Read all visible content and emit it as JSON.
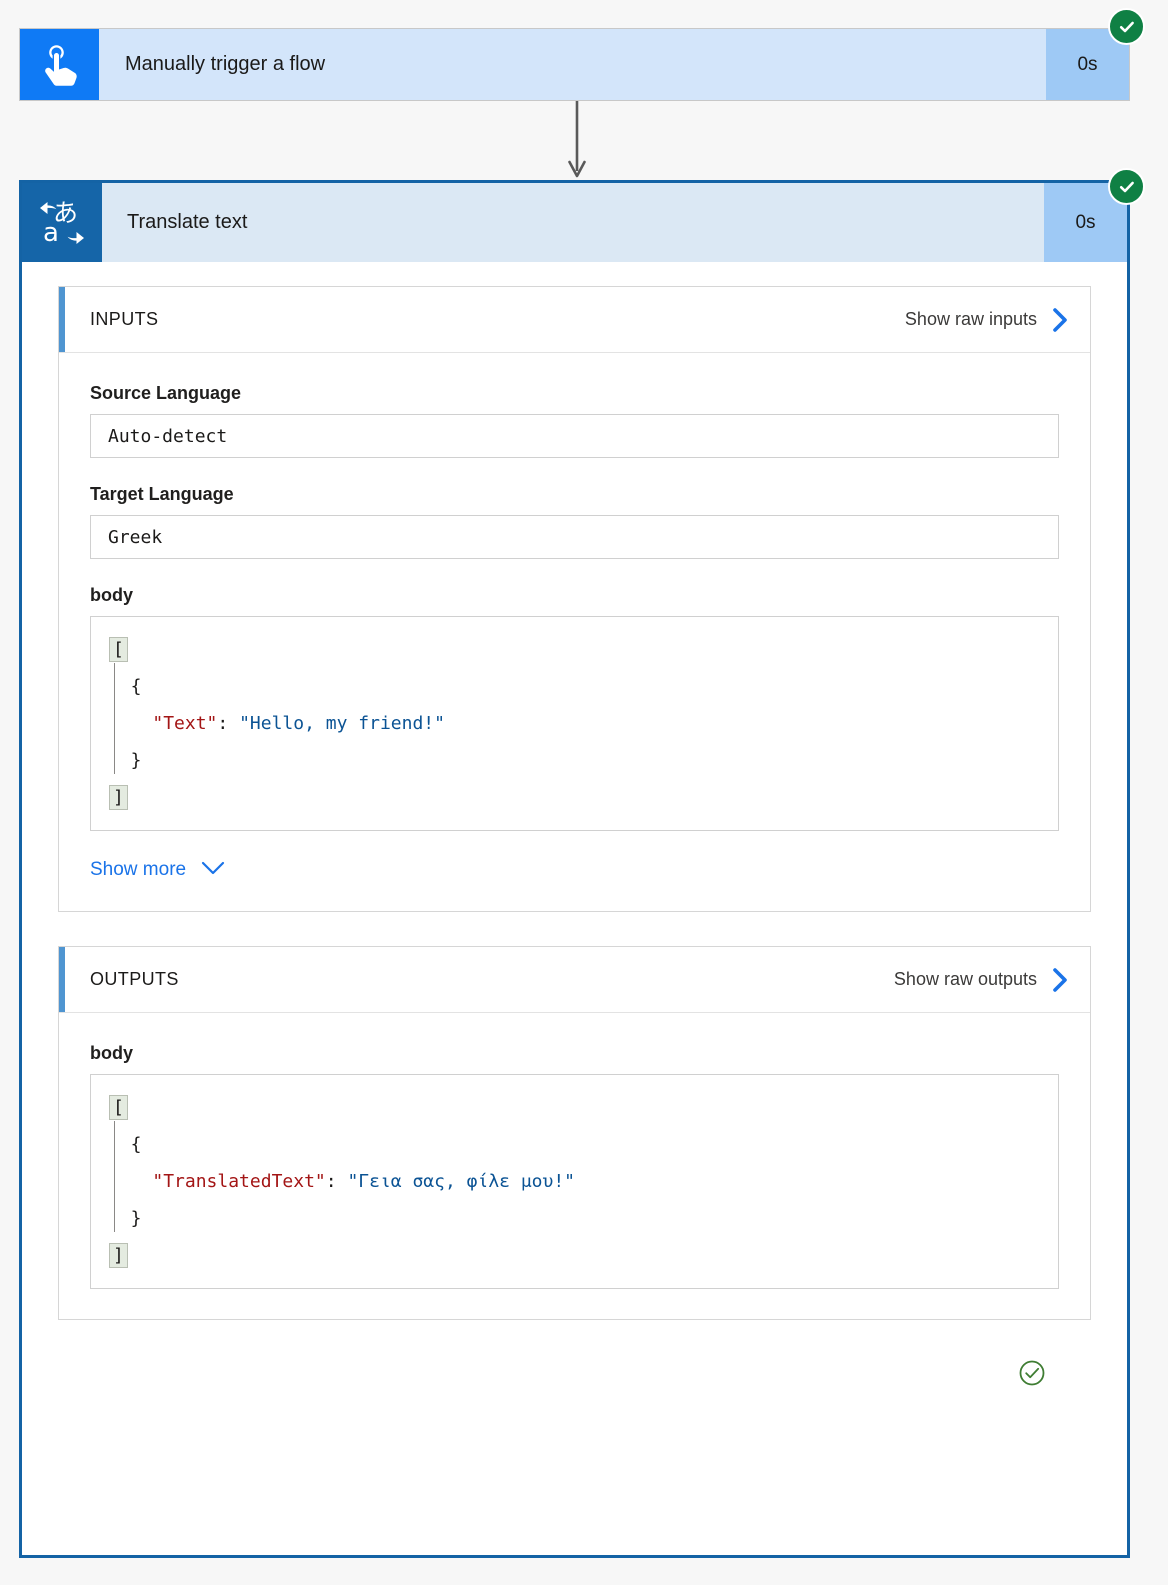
{
  "trigger": {
    "icon": "tap-hand-icon",
    "title": "Manually trigger a flow",
    "duration": "0s",
    "status": "succeeded"
  },
  "action": {
    "icon": "translate-icon",
    "title": "Translate text",
    "duration": "0s",
    "status": "succeeded",
    "footer_status_icon": "check-circle-outline-icon"
  },
  "inputs": {
    "title": "INPUTS",
    "raw_link": "Show raw inputs",
    "raw_link_icon": "chevron-right-icon",
    "fields": [
      {
        "label": "Source Language",
        "value": "Auto-detect"
      },
      {
        "label": "Target Language",
        "value": "Greek"
      }
    ],
    "body_label": "body",
    "body_lines": [
      {
        "type": "bracket",
        "text": "["
      },
      {
        "type": "punct",
        "text": "  {"
      },
      {
        "type": "pair",
        "indent": "    ",
        "key": "\"Text\"",
        "sep": ": ",
        "value": "\"Hello, my friend!\""
      },
      {
        "type": "punct",
        "text": "  }"
      },
      {
        "type": "bracket",
        "text": "]"
      }
    ],
    "show_more": "Show more",
    "show_more_icon": "chevron-down-icon"
  },
  "outputs": {
    "title": "OUTPUTS",
    "raw_link": "Show raw outputs",
    "raw_link_icon": "chevron-right-icon",
    "body_label": "body",
    "body_lines": [
      {
        "type": "bracket",
        "text": "["
      },
      {
        "type": "punct",
        "text": "  {"
      },
      {
        "type": "pair",
        "indent": "    ",
        "key": "\"TranslatedText\"",
        "sep": ": ",
        "value": "\"Γεια σας, φίλε μου!\""
      },
      {
        "type": "punct",
        "text": "  }"
      },
      {
        "type": "bracket",
        "text": "]"
      }
    ]
  },
  "colors": {
    "trigger_icon_bg": "#0f7af5",
    "trigger_title_bg": "#d3e5fa",
    "duration_bg": "#9ec9f5",
    "action_icon_bg": "#1565a8",
    "action_title_bg": "#dbe8f4",
    "action_border": "#1463a5",
    "status_green": "#0f8044",
    "accent_blue": "#4f95d1",
    "link_blue": "#1a73e8",
    "json_key": "#a31515",
    "json_string": "#0b5394",
    "page_bg": "#f7f7f7"
  }
}
